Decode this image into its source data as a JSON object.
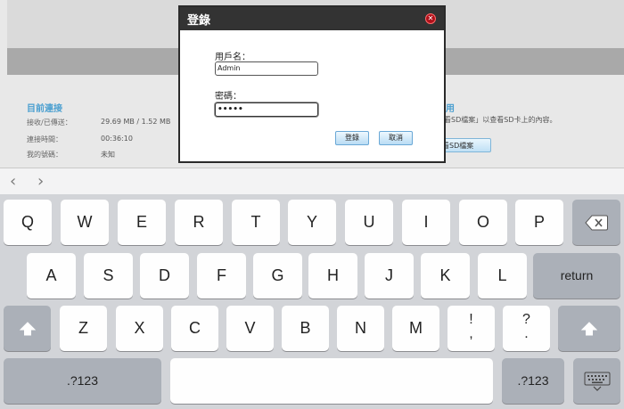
{
  "background": {
    "current_connection": {
      "title": "目前連接",
      "rows": [
        {
          "label": "接收/已傳送：",
          "value": "29.69 MB /  1.52 MB"
        },
        {
          "label": "連接時間：",
          "value": "00:36:10"
        },
        {
          "label": "我的號碼：",
          "value": "未知"
        }
      ]
    },
    "sd_section": {
      "title_partial": "用",
      "text": "「查看SD檔案」以查看SD卡上的內容。",
      "button_partial": "看SD檔案"
    }
  },
  "dialog": {
    "title": "登錄",
    "close_icon": "close-icon",
    "username_label": "用戶名：",
    "username_value": "Admin",
    "password_label": "密碼：",
    "password_value": "•••••",
    "login_button": "登錄",
    "cancel_button": "取消"
  },
  "accessory_bar": {
    "back_icon": "‹",
    "forward_icon": "›"
  },
  "keyboard": {
    "row1": [
      "Q",
      "W",
      "E",
      "R",
      "T",
      "Y",
      "U",
      "I",
      "O",
      "P"
    ],
    "row2": [
      "A",
      "S",
      "D",
      "F",
      "G",
      "H",
      "J",
      "K",
      "L"
    ],
    "row3": [
      "Z",
      "X",
      "C",
      "V",
      "B",
      "N",
      "M"
    ],
    "excl_top": "!",
    "excl_bottom": ",",
    "quest_top": "?",
    "quest_bottom": ".",
    "return_label": "return",
    "numbers_label": ".?123",
    "backspace_icon": "backspace-icon",
    "shift_icon": "shift-icon",
    "hide_keyboard_icon": "keyboard-hide-icon"
  }
}
